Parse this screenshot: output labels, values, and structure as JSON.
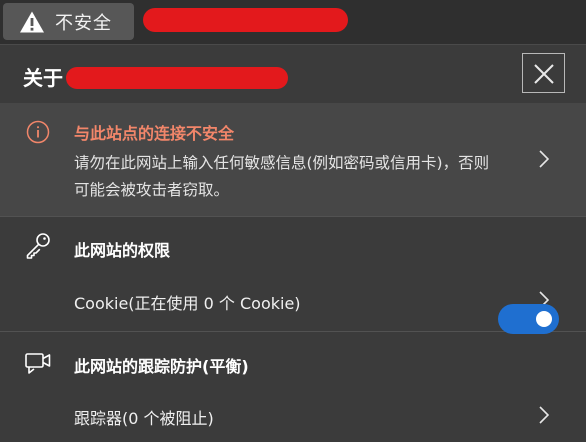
{
  "address_bar": {
    "security_label": "不安全"
  },
  "flyout": {
    "title_prefix": "关于",
    "warning": {
      "title": "与此站点的连接不安全",
      "description": "请勿在此网站上输入任何敏感信息(例如密码或信用卡)，否则可能会被攻击者窃取。"
    },
    "permissions": {
      "heading": "此网站的权限",
      "cookie_label": "Cookie(正在使用 0 个 Cookie)"
    },
    "tracking": {
      "heading": "此网站的跟踪防护(平衡)",
      "enabled": true,
      "trackers_label": "跟踪器(0 个被阻止)"
    }
  },
  "colors": {
    "warning_text": "#f2866a",
    "toggle_on": "#1f6fd0",
    "redaction": "#e3191c"
  }
}
